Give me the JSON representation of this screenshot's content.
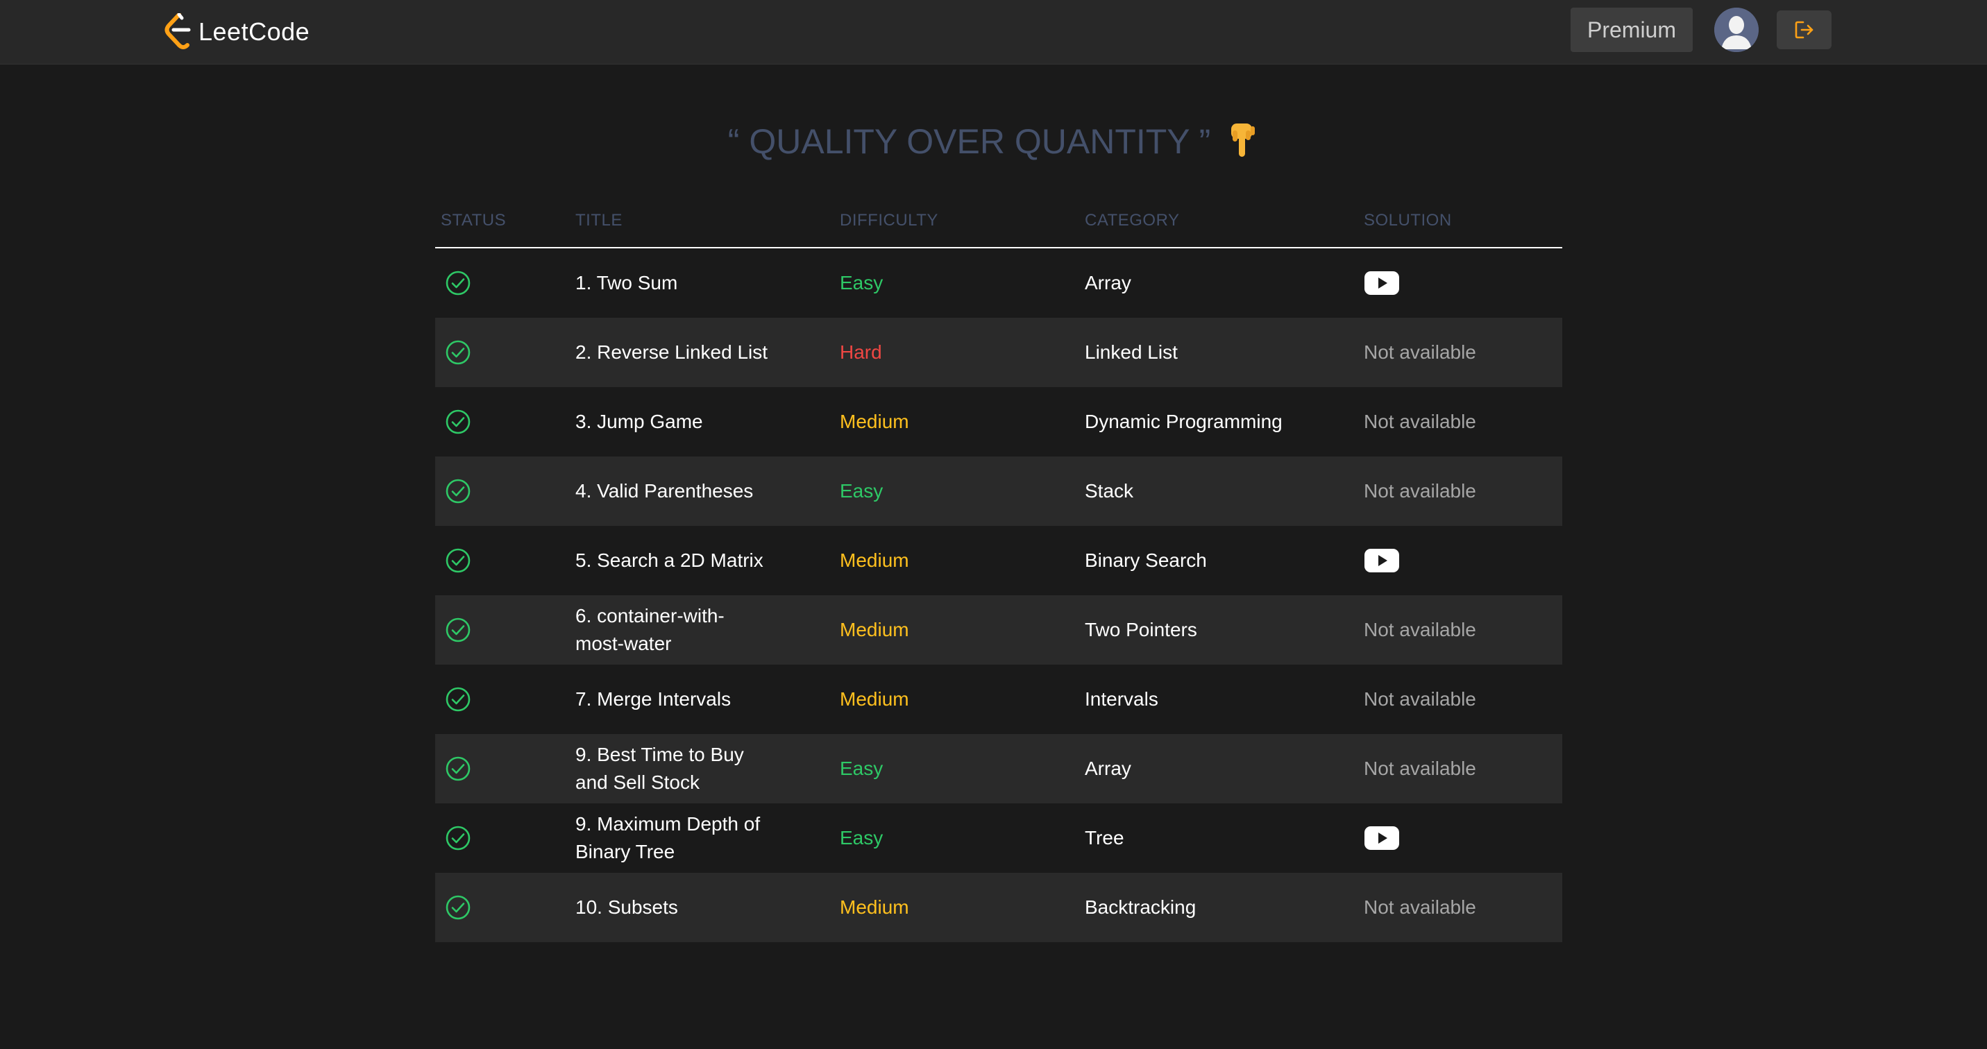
{
  "app": {
    "logo_text": "LeetCode"
  },
  "header": {
    "premium_label": "Premium"
  },
  "quote": {
    "text": "“ QUALITY OVER QUANTITY ”"
  },
  "table": {
    "columns": [
      "STATUS",
      "TITLE",
      "DIFFICULTY",
      "CATEGORY",
      "SOLUTION"
    ],
    "rows": [
      {
        "title": "1. Two Sum",
        "difficulty": "Easy",
        "category": "Array",
        "solution": "video"
      },
      {
        "title": "2. Reverse Linked List",
        "difficulty": "Hard",
        "category": "Linked List",
        "solution": "Not available"
      },
      {
        "title": "3. Jump Game",
        "difficulty": "Medium",
        "category": "Dynamic Programming",
        "solution": "Not available"
      },
      {
        "title": "4. Valid Parentheses",
        "difficulty": "Easy",
        "category": "Stack",
        "solution": "Not available"
      },
      {
        "title": "5. Search a 2D Matrix",
        "difficulty": "Medium",
        "category": "Binary Search",
        "solution": "video"
      },
      {
        "title": "6. container-with-most-water",
        "difficulty": "Medium",
        "category": "Two Pointers",
        "solution": "Not available"
      },
      {
        "title": "7. Merge Intervals",
        "difficulty": "Medium",
        "category": "Intervals",
        "solution": "Not available"
      },
      {
        "title": "9. Best Time to Buy and Sell Stock",
        "difficulty": "Easy",
        "category": "Array",
        "solution": "Not available"
      },
      {
        "title": "9. Maximum Depth of Binary Tree",
        "difficulty": "Easy",
        "category": "Tree",
        "solution": "video"
      },
      {
        "title": "10. Subsets",
        "difficulty": "Medium",
        "category": "Backtracking",
        "solution": "Not available"
      }
    ]
  },
  "colors": {
    "background": "#1a1a1a",
    "topbar": "#282828",
    "easy": "#2ec866",
    "medium": "#ffc01e",
    "hard": "#ef4743",
    "muted_heading": "#44506a",
    "brand_orange": "#ffa116"
  },
  "icons": {
    "status": "check-circle-icon",
    "solution_video": "youtube-icon",
    "logout": "logout-icon",
    "emoji": "pointing-down-icon"
  }
}
